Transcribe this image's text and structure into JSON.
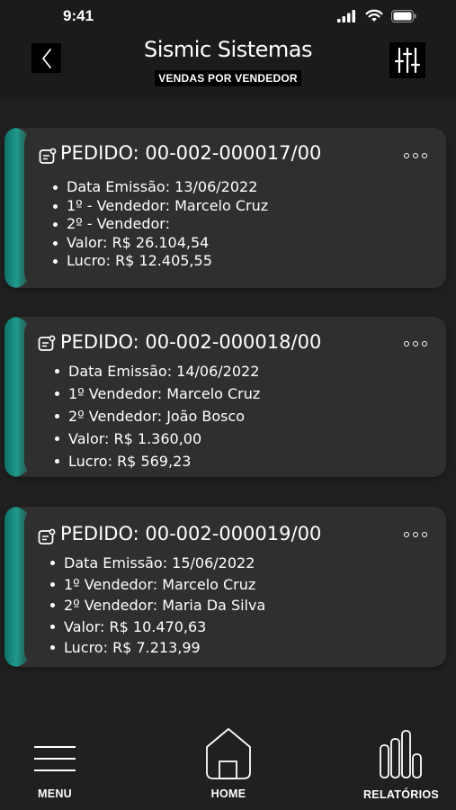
{
  "status_bar": {
    "time": "9:41",
    "icons": [
      "signal-icon",
      "wifi-icon",
      "battery-icon"
    ]
  },
  "header": {
    "title": "Sismic Sistemas",
    "subtitle": "VENDAS POR VENDEDOR",
    "back_icon": "chevron-left-icon",
    "filter_icon": "sliders-icon"
  },
  "orders": [
    {
      "title": "PEDIDO: 00-002-000017/00",
      "details": [
        "Data Emissão: 13/06/2022",
        "1º - Vendedor: Marcelo Cruz",
        "2º - Vendedor:",
        "Valor: R$ 26.104,54",
        "Lucro: R$ 12.405,55"
      ]
    },
    {
      "title": "PEDIDO: 00-002-000018/00",
      "details": [
        "Data Emissão: 14/06/2022",
        "1º Vendedor: Marcelo Cruz",
        "2º Vendedor: João Bosco",
        "Valor: R$ 1.360,00",
        "Lucro: R$ 569,23"
      ]
    },
    {
      "title": "PEDIDO: 00-002-000019/00",
      "details": [
        "Data Emissão: 15/06/2022",
        "1º Vendedor: Marcelo Cruz",
        "2º Vendedor: Maria Da Silva",
        "Valor: R$ 10.470,63",
        "Lucro: R$ 7.213,99"
      ]
    }
  ],
  "bottom_nav": {
    "menu_label": "MENU",
    "home_label": "HOME",
    "reports_label": "RELATÓRIOS"
  },
  "colors": {
    "background": "#202020",
    "card": "#2f2f2f",
    "accent": "#1e9a8a",
    "header": "#1b1b1b"
  }
}
